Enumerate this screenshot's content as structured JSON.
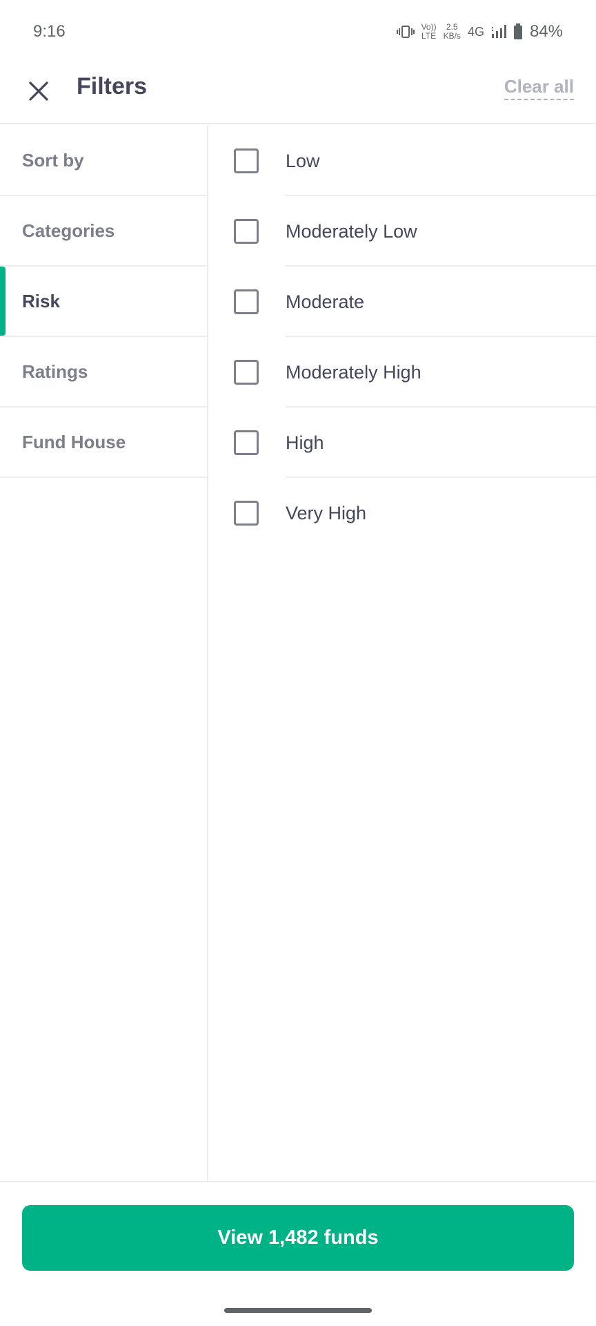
{
  "status_bar": {
    "time": "9:16",
    "volte_top": "Vo))",
    "volte_bottom": "LTE",
    "speed_top": "2.5",
    "speed_bottom": "KB/s",
    "network": "4G",
    "battery": "84%",
    "icons": [
      "vibrate-icon",
      "volte-icon",
      "signal-icon",
      "battery-icon"
    ]
  },
  "header": {
    "title": "Filters",
    "clear_label": "Clear all",
    "close_icon": "close-icon"
  },
  "sidebar": {
    "items": [
      {
        "label": "Sort by",
        "active": false
      },
      {
        "label": "Categories",
        "active": false
      },
      {
        "label": "Risk",
        "active": true
      },
      {
        "label": "Ratings",
        "active": false
      },
      {
        "label": "Fund House",
        "active": false
      }
    ]
  },
  "options": {
    "items": [
      {
        "label": "Low",
        "checked": false
      },
      {
        "label": "Moderately Low",
        "checked": false
      },
      {
        "label": "Moderate",
        "checked": false
      },
      {
        "label": "Moderately High",
        "checked": false
      },
      {
        "label": "High",
        "checked": false
      },
      {
        "label": "Very High",
        "checked": false
      }
    ]
  },
  "footer": {
    "cta_label": "View 1,482 funds"
  },
  "colors": {
    "accent": "#00b386",
    "text_primary": "#44475b",
    "text_secondary": "#7c7e8c",
    "divider": "#ebecf0"
  }
}
